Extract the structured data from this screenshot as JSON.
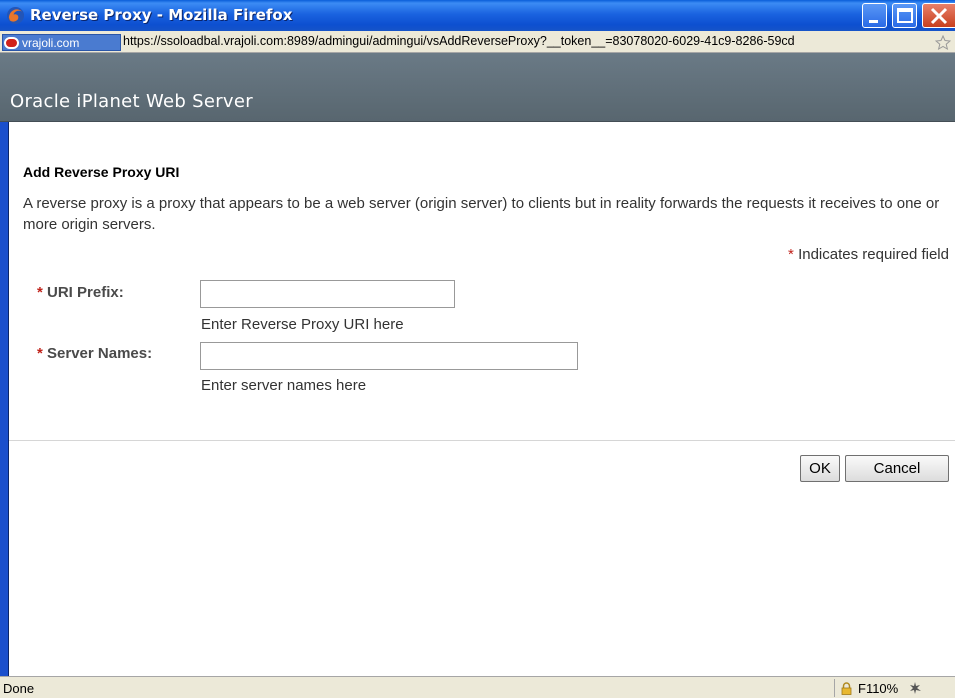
{
  "window": {
    "title": "Reverse Proxy - Mozilla Firefox",
    "icon": "firefox-icon",
    "controls": [
      "minimize",
      "maximize",
      "close"
    ]
  },
  "addressbar": {
    "site_identity": "vrajoli.com",
    "url": "https://ssoloadbal.vrajoli.com:8989/admingui/admingui/vsAddReverseProxy?__token__=83078020-6029-41c9-8286-59cd"
  },
  "app": {
    "header_title": "Oracle iPlanet Web Server"
  },
  "form": {
    "heading": "Add Reverse Proxy URI",
    "description": "A reverse proxy is a proxy that appears to be a web server (origin server) to clients but in reality forwards the requests it receives to one or more origin servers.",
    "required_star": "*",
    "required_note": "Indicates required field",
    "fields": [
      {
        "label": "URI Prefix:",
        "value": "",
        "help": "Enter Reverse Proxy URI here"
      },
      {
        "label": "Server Names:",
        "value": "",
        "help": "Enter server names here"
      }
    ],
    "ok_label": "OK",
    "cancel_label": "Cancel"
  },
  "statusbar": {
    "status": "Done",
    "zoom": "F110%"
  },
  "colors": {
    "title_bar": "#1a63e0",
    "header_bg": "#5f6d77",
    "required_star": "#c0221a"
  }
}
